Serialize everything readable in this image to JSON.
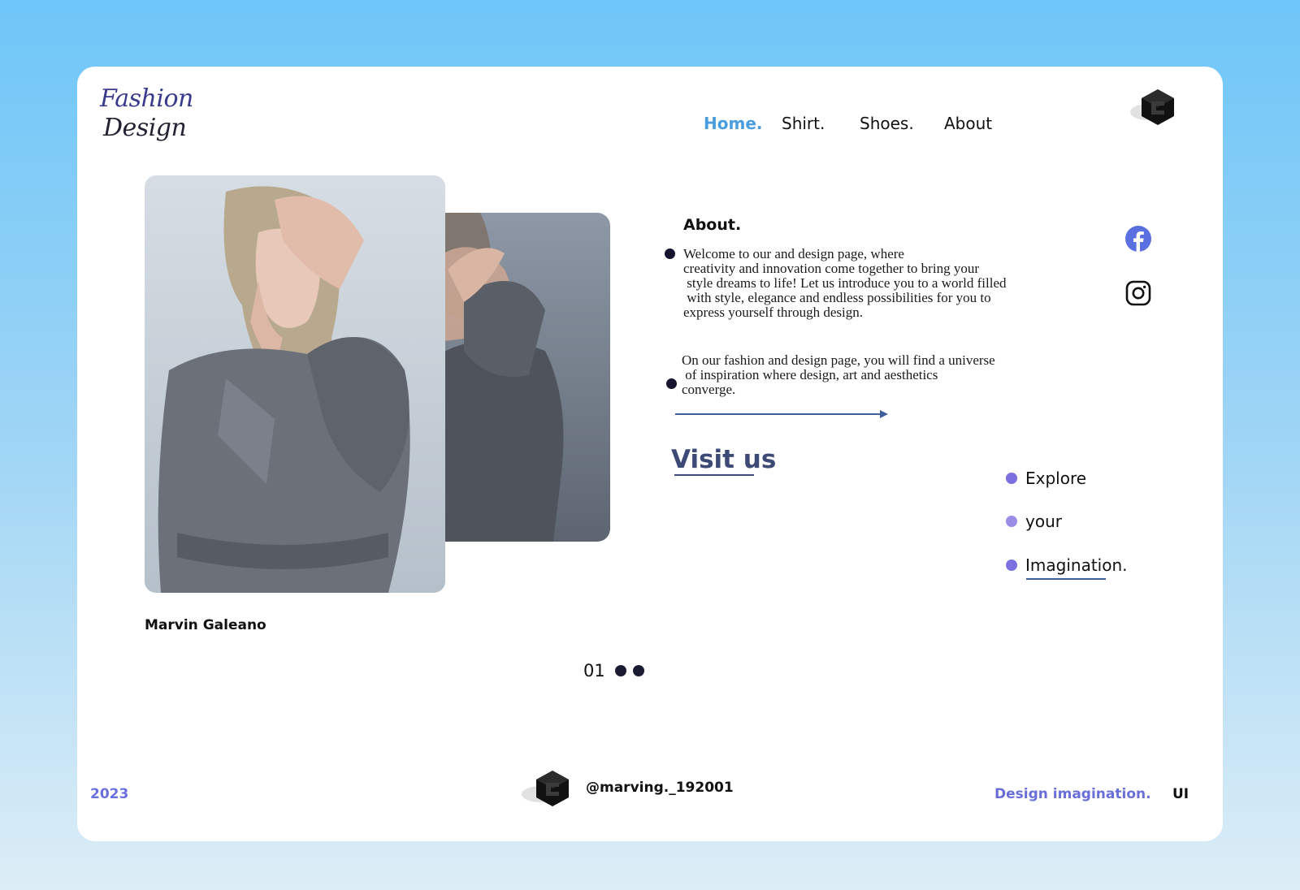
{
  "brand": {
    "logo_line1": "Fashion",
    "logo_line2": "Design"
  },
  "nav": {
    "items": [
      {
        "label": "Home.",
        "active": true
      },
      {
        "label": "Shirt.",
        "active": false
      },
      {
        "label": "Shoes.",
        "active": false
      },
      {
        "label": "About",
        "active": false
      }
    ]
  },
  "hero": {
    "author": "Marvin Galeano"
  },
  "pager": {
    "current": "01"
  },
  "about": {
    "title": "About.",
    "paragraph1": "Welcome to our and design page, where\ncreativity and innovation come together to bring your\n style dreams to life! Let us introduce you to a world filled\n with style, elegance and endless possibilities for you to\nexpress yourself through design.",
    "paragraph2": "On our fashion and design page, you will find a universe\n of inspiration where design, art and aesthetics\nconverge."
  },
  "cta": {
    "visit_label": "Visit us"
  },
  "social": {
    "icons": [
      "facebook-icon",
      "instagram-icon"
    ]
  },
  "explore": {
    "items": [
      "Explore",
      "your",
      "Imagination."
    ]
  },
  "footer": {
    "year": "2023",
    "handle": "@marving._192001",
    "tagline": "Design imagination.",
    "ui_label": "UI"
  },
  "colors": {
    "accent": "#4a9ee0",
    "purple": "#6a6fe0",
    "navy": "#3e4a76",
    "bullet_dark": "#14142e",
    "explore_dot": "#7c6fe0"
  }
}
